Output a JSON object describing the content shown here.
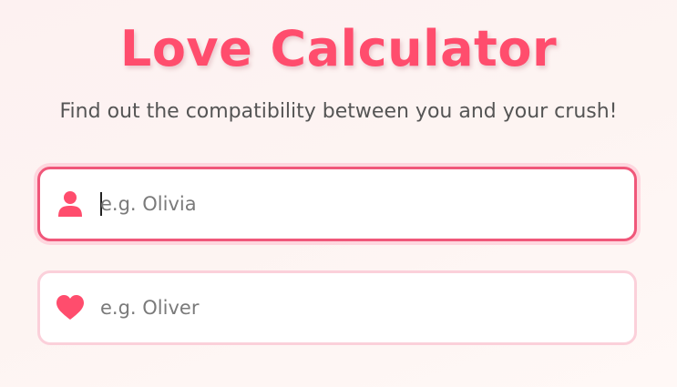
{
  "app": {
    "title": "Love Calculator",
    "subtitle": "Find out the compatibility between you and your crush!"
  },
  "form": {
    "your_name": {
      "value": "",
      "placeholder": "e.g. Olivia",
      "icon": "user-icon",
      "focused": true
    },
    "crush_name": {
      "value": "",
      "placeholder": "e.g. Oliver",
      "icon": "heart-icon",
      "focused": false
    }
  },
  "colors": {
    "accent": "#ff4d6d",
    "focus_border": "#f0577a",
    "idle_border": "#fbd0da",
    "background": "#fdf2f1",
    "subtitle_text": "#555555"
  }
}
